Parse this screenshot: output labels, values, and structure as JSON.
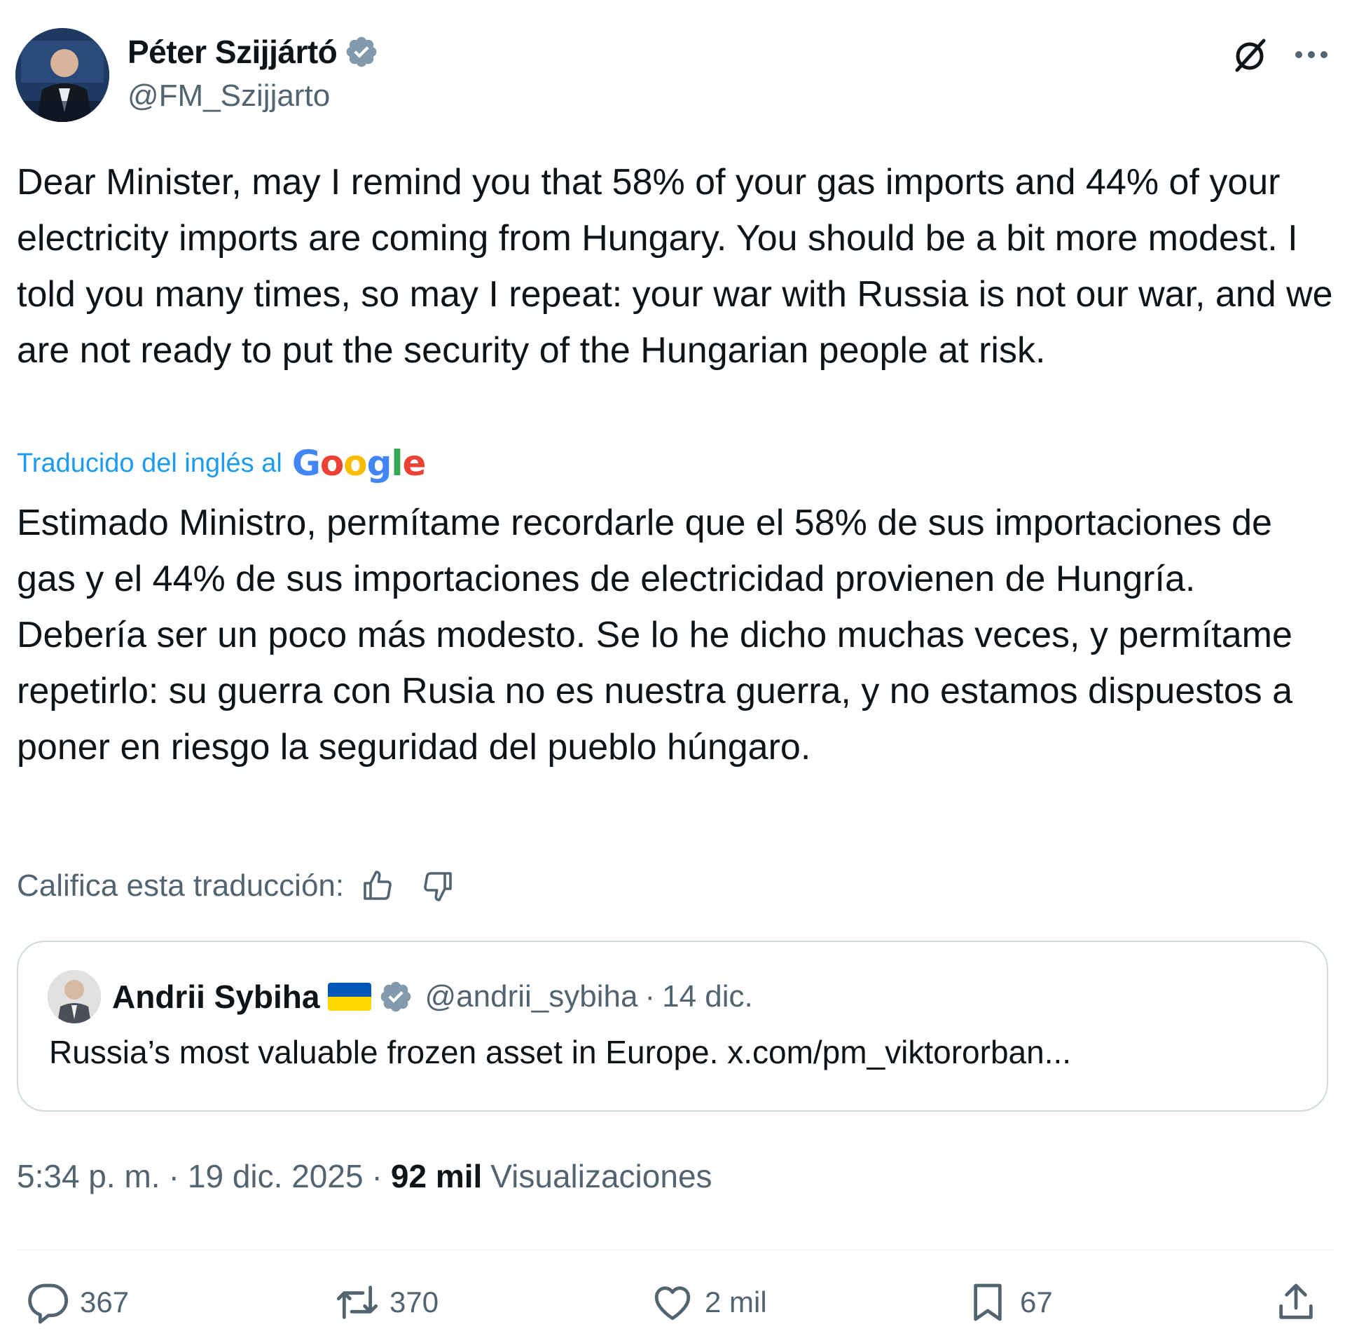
{
  "author": {
    "display_name": "Péter Szijjártó",
    "handle": "@FM_Szijjarto",
    "verified_icon": "verified-badge-icon"
  },
  "header_actions": {
    "grok_icon": "grok-icon",
    "more_icon": "more-icon"
  },
  "body": {
    "text": "Dear Minister, may I remind you that 58% of your gas imports and 44% of your electricity imports are coming from Hungary. You should be a bit more modest. I told you many times, so may I repeat: your war with Russia is not our war, and we are not ready to put the security of the Hungarian people at risk.",
    "translated_label": "Traducido del inglés al",
    "translator_brand": [
      "G",
      "o",
      "o",
      "g",
      "l",
      "e"
    ],
    "translated_text": "Estimado Ministro, permítame recordarle que el 58% de sus importaciones de gas y el 44% de sus importaciones de electricidad provienen de Hungría. Debería ser un poco más modesto. Se lo he dicho muchas veces, y permítame repetirlo: su guerra con Rusia no es nuestra guerra, y no estamos dispuestos a poner en riesgo la seguridad del pueblo húngaro.",
    "rate_label": "Califica esta traducción:"
  },
  "quote": {
    "display_name": "Andrii Sybiha",
    "flag": "ukraine-flag",
    "handle": "@andrii_sybiha",
    "separator": "·",
    "date": "14 dic.",
    "text": "Russia’s most valuable frozen asset in Europe. x.com/pm_viktororban..."
  },
  "meta": {
    "time": "5:34 p. m.",
    "separator": "·",
    "date": "19 dic. 2025",
    "views_count": "92 mil",
    "views_label": "Visualizaciones"
  },
  "actions": {
    "reply_count": "367",
    "retweet_count": "370",
    "like_count": "2 mil",
    "bookmark_count": "67"
  },
  "colors": {
    "link_blue": "#1d9bf0",
    "text_primary": "#0f1419",
    "text_secondary": "#536471",
    "border": "#cfd9de"
  }
}
